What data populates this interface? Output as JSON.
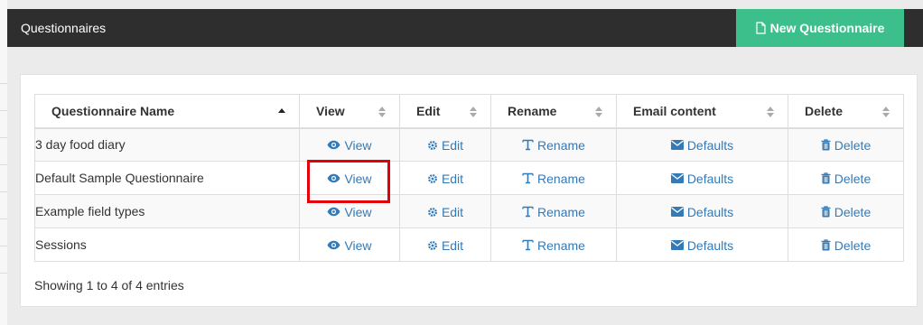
{
  "header": {
    "title": "Questionnaires",
    "new_button_label": "New Questionnaire"
  },
  "table": {
    "columns": [
      "Questionnaire Name",
      "View",
      "Edit",
      "Rename",
      "Email content",
      "Delete"
    ],
    "action_labels": {
      "view": "View",
      "edit": "Edit",
      "rename": "Rename",
      "email": "Defaults",
      "delete": "Delete"
    },
    "rows": [
      {
        "name": "3 day food diary"
      },
      {
        "name": "Default Sample Questionnaire"
      },
      {
        "name": "Example field types"
      },
      {
        "name": "Sessions"
      }
    ]
  },
  "footer": {
    "info": "Showing 1 to 4 of 4 entries"
  },
  "colors": {
    "topbar": "#2e2e2e",
    "accent": "#3cbf8a",
    "link": "#337ab7",
    "highlight": "#e3000b"
  }
}
